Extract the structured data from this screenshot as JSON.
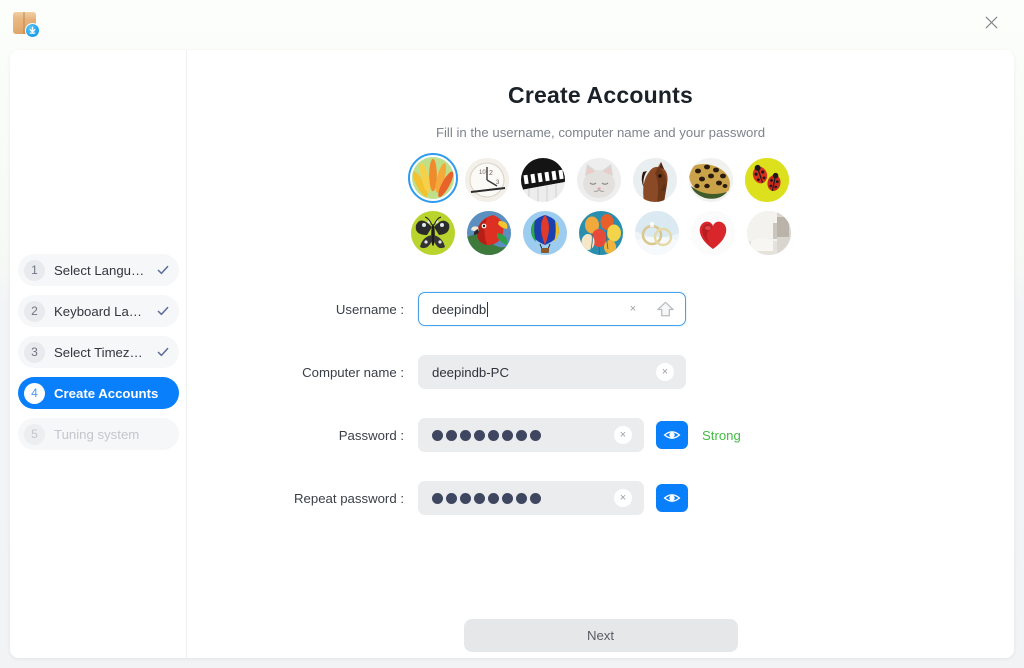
{
  "window": {
    "app_icon": "package-download-icon",
    "close_label": "×"
  },
  "sidebar": {
    "steps": [
      {
        "number": "1",
        "label": "Select Langu…",
        "state": "done"
      },
      {
        "number": "2",
        "label": "Keyboard La…",
        "state": "done"
      },
      {
        "number": "3",
        "label": "Select Timez…",
        "state": "done"
      },
      {
        "number": "4",
        "label": "Create Accounts",
        "state": "active"
      },
      {
        "number": "5",
        "label": "Tuning system",
        "state": "pending"
      }
    ]
  },
  "page": {
    "title": "Create Accounts",
    "subtitle": "Fill in the username, computer name and your password"
  },
  "avatars": {
    "selected_index": 0,
    "row1": [
      {
        "name": "avatar-flower",
        "selected": true
      },
      {
        "name": "avatar-clock",
        "selected": false
      },
      {
        "name": "avatar-piano",
        "selected": false
      },
      {
        "name": "avatar-cat",
        "selected": false
      },
      {
        "name": "avatar-horse",
        "selected": false
      },
      {
        "name": "avatar-leopard",
        "selected": false
      },
      {
        "name": "avatar-ladybug",
        "selected": false
      }
    ],
    "row2": [
      {
        "name": "avatar-butterfly",
        "selected": false
      },
      {
        "name": "avatar-parrot",
        "selected": false
      },
      {
        "name": "avatar-hot-air-balloon",
        "selected": false
      },
      {
        "name": "avatar-party-balloons",
        "selected": false
      },
      {
        "name": "avatar-wedding-rings",
        "selected": false
      },
      {
        "name": "avatar-heart",
        "selected": false
      },
      {
        "name": "avatar-room",
        "selected": false
      }
    ]
  },
  "form": {
    "username": {
      "label": "Username :",
      "value": "deepindb",
      "placeholder": "Username",
      "focused": true,
      "clear_icon": "×",
      "caps_icon": "caps-lock-icon"
    },
    "computer_name": {
      "label": "Computer name :",
      "value": "deepindb-PC",
      "placeholder": "Computer name",
      "clear_icon": "×"
    },
    "password": {
      "label": "Password :",
      "masked_length": 8,
      "placeholder": "Password",
      "clear_icon": "×",
      "reveal_icon": "eye-icon",
      "strength": "Strong",
      "strength_color": "#44bb44"
    },
    "repeat_password": {
      "label": "Repeat password :",
      "masked_length": 8,
      "placeholder": "Repeat password",
      "clear_icon": "×",
      "reveal_icon": "eye-icon"
    }
  },
  "footer": {
    "next_label": "Next"
  },
  "colors": {
    "accent": "#0a7ffb",
    "focus_border": "#4aa3e8",
    "success": "#44bb44",
    "field_bg": "#ebecee"
  }
}
